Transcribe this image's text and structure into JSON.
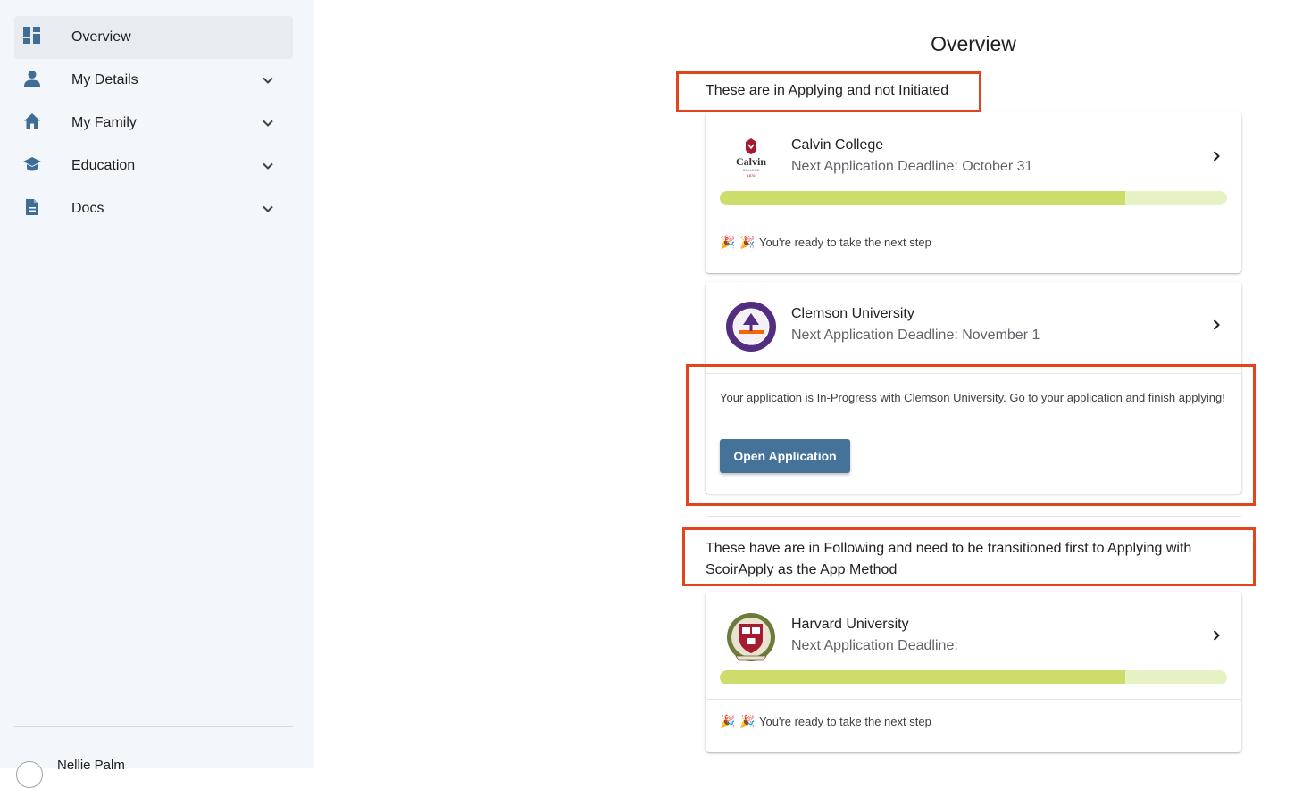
{
  "sidebar": {
    "items": [
      {
        "label": "Overview",
        "icon": "dashboard-icon",
        "active": true
      },
      {
        "label": "My Details",
        "icon": "person-icon"
      },
      {
        "label": "My Family",
        "icon": "home-icon"
      },
      {
        "label": "Education",
        "icon": "school-icon"
      },
      {
        "label": "Docs",
        "icon": "document-icon"
      }
    ],
    "user_name": "Nellie Palm"
  },
  "main": {
    "title": "Overview",
    "annotation_applying": "These are in Applying and not Initiated",
    "annotation_following": "These have are in Following and need to be transitioned first to Applying with ScoirApply as the App Method",
    "cards": [
      {
        "school": "Calvin College",
        "deadline": "Next Application Deadline: October 31",
        "progress": 0.8,
        "status": "You're ready to take the next step"
      },
      {
        "school": "Clemson University",
        "deadline": "Next Application Deadline: November 1",
        "message": "Your application is In-Progress with Clemson University. Go to your application and finish applying!",
        "button": "Open Application"
      },
      {
        "school": "Harvard University",
        "deadline": "Next Application Deadline:",
        "progress": 0.8,
        "status": "You're ready to take the next step"
      }
    ]
  },
  "colors": {
    "sidebar_bg": "#f3f6fa",
    "icon": "#3f6d96",
    "annotation": "#e2451c",
    "progress_fill": "#cddc6b",
    "progress_track": "#e6f1c4",
    "button": "#457298"
  }
}
